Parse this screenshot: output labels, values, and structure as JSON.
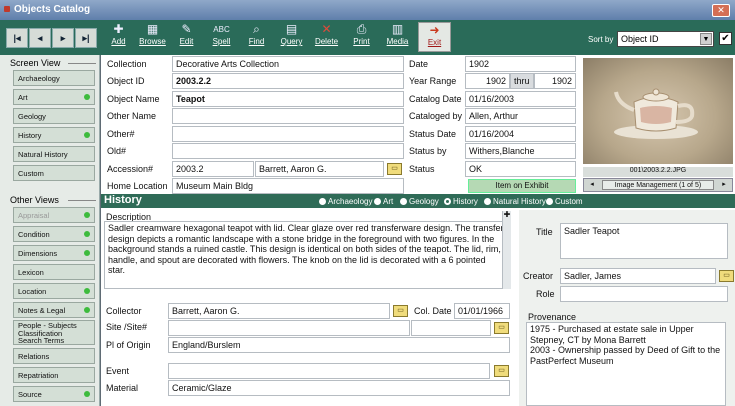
{
  "window": {
    "title": "Objects Catalog",
    "close_glyph": "✕"
  },
  "toolbar": {
    "nav": [
      "|◂",
      "◂",
      "▸",
      "▸|"
    ],
    "tools": [
      {
        "label": "Add",
        "icon": "add-icon",
        "glyph": "✚"
      },
      {
        "label": "Browse",
        "icon": "browse-icon",
        "glyph": "▦"
      },
      {
        "label": "Edit",
        "icon": "edit-icon",
        "glyph": "✎"
      },
      {
        "label": "Spell",
        "icon": "spell-icon",
        "glyph": "ABC"
      },
      {
        "label": "Find",
        "icon": "binoculars-icon",
        "glyph": "⌕"
      },
      {
        "label": "Query",
        "icon": "query-icon",
        "glyph": "▤"
      },
      {
        "label": "Delete",
        "icon": "delete-icon",
        "glyph": "✕"
      },
      {
        "label": "Print",
        "icon": "printer-icon",
        "glyph": "⎙"
      },
      {
        "label": "Media",
        "icon": "media-icon",
        "glyph": "▥"
      },
      {
        "label": "Exit",
        "icon": "exit-icon",
        "glyph": "➜"
      }
    ],
    "sort_label": "Sort by",
    "sort_value": "Object ID",
    "sort_arrow": "▼",
    "check": "✔"
  },
  "sidebar": {
    "screen_view_header": "Screen View",
    "screen_views": [
      {
        "label": "Archaeology",
        "dot": false
      },
      {
        "label": "Art",
        "dot": true
      },
      {
        "label": "Geology",
        "dot": false
      },
      {
        "label": "History",
        "dot": true
      },
      {
        "label": "Natural History",
        "dot": false
      },
      {
        "label": "Custom",
        "dot": false
      }
    ],
    "other_views_header": "Other Views",
    "other_views": [
      {
        "label": "Appraisal",
        "dot": true,
        "dim": true
      },
      {
        "label": "Condition",
        "dot": true
      },
      {
        "label": "Dimensions",
        "dot": true
      },
      {
        "label": "Lexicon",
        "dot": false
      },
      {
        "label": "Location",
        "dot": true
      },
      {
        "label": "Notes & Legal",
        "dot": true
      }
    ],
    "people_lines": [
      "People - Subjects",
      "Classification",
      "Search Terms"
    ],
    "bottom_views": [
      {
        "label": "Relations",
        "dot": false
      },
      {
        "label": "Repatriation",
        "dot": false
      },
      {
        "label": "Source",
        "dot": true
      }
    ]
  },
  "record": {
    "collection_label": "Collection",
    "collection": "Decorative Arts Collection",
    "objectid_label": "Object ID",
    "objectid": "2003.2.2",
    "objectname_label": "Object Name",
    "objectname": "Teapot",
    "othername_label": "Other Name",
    "othername": "",
    "othernum_label": "Other#",
    "othernum": "",
    "old_label": "Old#",
    "old": "",
    "accession_label": "Accession#",
    "accession": "2003.2",
    "accession_donor": "Barrett, Aaron G.",
    "homeloc_label": "Home Location",
    "homeloc": "Museum Main Bldg",
    "date_label": "Date",
    "date": "1902",
    "yearrange_label": "Year Range",
    "year_from": "1902",
    "thru": "thru",
    "year_to": "1902",
    "catdate_label": "Catalog Date",
    "catdate": "01/16/2003",
    "catby_label": "Cataloged by",
    "catby": "Allen, Arthur",
    "statusdate_label": "Status Date",
    "statusdate": "01/16/2004",
    "statusby_label": "Status by",
    "statusby": "Withers,Blanche",
    "status_label": "Status",
    "status": "OK",
    "exhibit": "Item on Exhibit"
  },
  "image": {
    "filename": "001\\2003.2.2.JPG",
    "manage_label": "Image Management (1 of 5)",
    "prev": "◂",
    "next": "▸"
  },
  "history": {
    "header": "History",
    "views": [
      {
        "label": "Archaeology",
        "selected": false
      },
      {
        "label": "Art",
        "selected": false
      },
      {
        "label": "Geology",
        "selected": false
      },
      {
        "label": "History",
        "selected": true
      },
      {
        "label": "Natural History",
        "selected": false
      },
      {
        "label": "Custom",
        "selected": false
      }
    ],
    "description_label": "Description",
    "description": "Sadler creamware hexagonal teapot with lid. Clear glaze over red transferware design. The transfer design depicts a romantic landscape with a stone bridge in the foreground with two figures. In the background stands a ruined castle. This design is identical on both sides of the teapot. The lid, rim, handle, and spout are decorated with flowers. The knob on the lid is decorated with a 6 pointed star.",
    "collector_label": "Collector",
    "collector": "Barrett, Aaron G.",
    "coldate_label": "Col. Date",
    "coldate": "01/01/1966",
    "site_label": "Site /Site#",
    "site": "",
    "origin_label": "Pl of Origin",
    "origin": "England/Burslem",
    "event_label": "Event",
    "event": "",
    "material_label": "Material",
    "material": "Ceramic/Glaze",
    "title_label": "Title",
    "title": "Sadler Teapot",
    "creator_label": "Creator",
    "creator": "Sadler, James",
    "role_label": "Role",
    "role": "",
    "provenance_label": "Provenance",
    "provenance": "1975 - Purchased at estate sale in Upper Stepney, CT by Mona Barrett\n2003 - Ownership passed by Deed of Gift to the PastPerfect Museum"
  },
  "colors": {
    "toolbar": "#2a6b59",
    "history_bar": "#2f6b57",
    "sidebar": "#e6ebe7",
    "dot": "#3dbb3d"
  }
}
